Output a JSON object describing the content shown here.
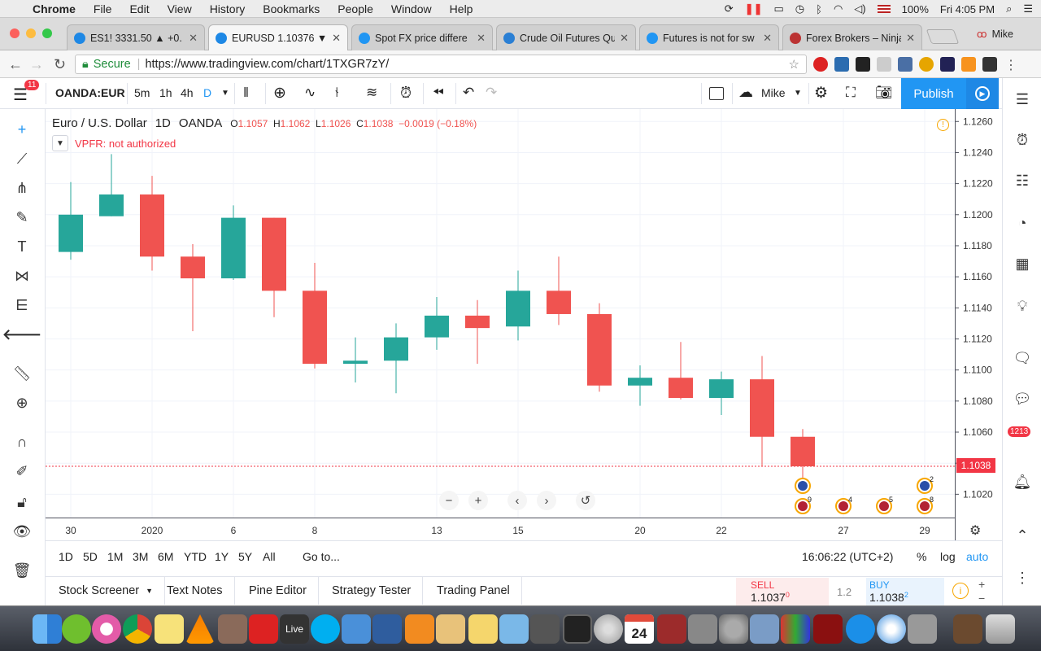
{
  "menubar": {
    "app": "Chrome",
    "items": [
      "File",
      "Edit",
      "View",
      "History",
      "Bookmarks",
      "People",
      "Window",
      "Help"
    ],
    "battery": "100%",
    "clock": "Fri 4:05 PM"
  },
  "tabs": [
    {
      "title": "ES1! 3331.50 ▲ +0.",
      "icon_color": "#1e88e5",
      "active": false
    },
    {
      "title": "EURUSD 1.10376 ▼",
      "icon_color": "#1e88e5",
      "active": true
    },
    {
      "title": "Spot FX price differe",
      "icon_color": "#2196f3",
      "active": false
    },
    {
      "title": "Crude Oil Futures Qu",
      "icon_color": "#2a7fd4",
      "active": false
    },
    {
      "title": "Futures is not for sw",
      "icon_color": "#2196f3",
      "active": false
    },
    {
      "title": "Forex Brokers – Ninja",
      "icon_color": "#b33",
      "active": false
    }
  ],
  "profile": "Mike",
  "address": {
    "secure": "Secure",
    "url": "https://www.tradingview.com/chart/1TXGR7zY/"
  },
  "toolbar": {
    "notif_count": "11",
    "symbol": "OANDA:EUR",
    "intervals": [
      "5m",
      "1h",
      "4h",
      "D"
    ],
    "user": "Mike",
    "publish": "Publish"
  },
  "legend": {
    "name": "Euro / U.S. Dollar",
    "interval": "1D",
    "source": "OANDA",
    "open": "1.1057",
    "high": "1.1062",
    "low": "1.1026",
    "close": "1.1038",
    "change": "−0.0019 (−0.18%)"
  },
  "vpfr": "VPFR: not authorized",
  "price_tag": "1.1038",
  "chart_data": {
    "type": "candlestick",
    "y_ticks": [
      "1.1260",
      "1.1240",
      "1.1220",
      "1.1200",
      "1.1180",
      "1.1160",
      "1.1140",
      "1.1120",
      "1.1100",
      "1.1080",
      "1.1060",
      "1.1040",
      "1.1020"
    ],
    "ylim": [
      1.1005,
      1.1268
    ],
    "x_ticks": [
      {
        "label": "30",
        "i": 0
      },
      {
        "label": "2020",
        "i": 2
      },
      {
        "label": "6",
        "i": 4
      },
      {
        "label": "8",
        "i": 6
      },
      {
        "label": "13",
        "i": 9
      },
      {
        "label": "15",
        "i": 11
      },
      {
        "label": "20",
        "i": 14
      },
      {
        "label": "22",
        "i": 16
      },
      {
        "label": "27",
        "i": 19
      },
      {
        "label": "29",
        "i": 21
      }
    ],
    "candles": [
      {
        "o": 1.1176,
        "h": 1.1221,
        "l": 1.1171,
        "c": 1.12
      },
      {
        "o": 1.1199,
        "h": 1.1239,
        "l": 1.1199,
        "c": 1.1213
      },
      {
        "o": 1.1213,
        "h": 1.1225,
        "l": 1.1164,
        "c": 1.1173
      },
      {
        "o": 1.1173,
        "h": 1.1181,
        "l": 1.1125,
        "c": 1.1159
      },
      {
        "o": 1.1159,
        "h": 1.1206,
        "l": 1.1158,
        "c": 1.1198
      },
      {
        "o": 1.1198,
        "h": 1.1198,
        "l": 1.1134,
        "c": 1.1151
      },
      {
        "o": 1.1151,
        "h": 1.1169,
        "l": 1.1101,
        "c": 1.1104
      },
      {
        "o": 1.1104,
        "h": 1.1121,
        "l": 1.1092,
        "c": 1.1106
      },
      {
        "o": 1.1106,
        "h": 1.113,
        "l": 1.1085,
        "c": 1.1121
      },
      {
        "o": 1.1121,
        "h": 1.1147,
        "l": 1.1113,
        "c": 1.1135
      },
      {
        "o": 1.1135,
        "h": 1.1145,
        "l": 1.1104,
        "c": 1.1127
      },
      {
        "o": 1.1128,
        "h": 1.1164,
        "l": 1.1119,
        "c": 1.1151
      },
      {
        "o": 1.1151,
        "h": 1.1173,
        "l": 1.1129,
        "c": 1.1136
      },
      {
        "o": 1.1136,
        "h": 1.1143,
        "l": 1.1086,
        "c": 1.109
      },
      {
        "o": 1.109,
        "h": 1.1103,
        "l": 1.1077,
        "c": 1.1095
      },
      {
        "o": 1.1095,
        "h": 1.1118,
        "l": 1.1081,
        "c": 1.1082
      },
      {
        "o": 1.1082,
        "h": 1.1099,
        "l": 1.1071,
        "c": 1.1094
      },
      {
        "o": 1.1094,
        "h": 1.1109,
        "l": 1.1038,
        "c": 1.1057
      },
      {
        "o": 1.1057,
        "h": 1.1062,
        "l": 1.1026,
        "c": 1.1038
      }
    ],
    "colors": {
      "up": "#26a69a",
      "down": "#f05350"
    },
    "last_price": 1.1038
  },
  "events": [
    {
      "i": 18,
      "count": "",
      "flag": "eu",
      "row": 0
    },
    {
      "i": 18,
      "count": "9",
      "flag": "us",
      "row": 1
    },
    {
      "i": 19,
      "count": "4",
      "flag": "us",
      "row": 1
    },
    {
      "i": 20,
      "count": "5",
      "flag": "us",
      "row": 1
    },
    {
      "i": 21,
      "count": "2",
      "flag": "eu",
      "row": 0
    },
    {
      "i": 21,
      "count": "8",
      "flag": "us",
      "row": 1
    }
  ],
  "ranges": {
    "buttons": [
      "1D",
      "5D",
      "1M",
      "3M",
      "6M",
      "YTD",
      "1Y",
      "5Y",
      "All"
    ],
    "goto": "Go to...",
    "time": "16:06:22 (UTC+2)",
    "percent": "%",
    "log": "log",
    "auto": "auto"
  },
  "bottom_tabs": [
    "Stock Screener",
    "Text Notes",
    "Pine Editor",
    "Strategy Tester",
    "Trading Panel"
  ],
  "trade": {
    "sell_label": "SELL",
    "sell_price": "1.1037",
    "sell_sup": "0",
    "spread": "1.2",
    "buy_label": "BUY",
    "buy_price": "1.1038",
    "buy_sup": "2"
  },
  "right_badge": "1213",
  "dock_date": "24"
}
